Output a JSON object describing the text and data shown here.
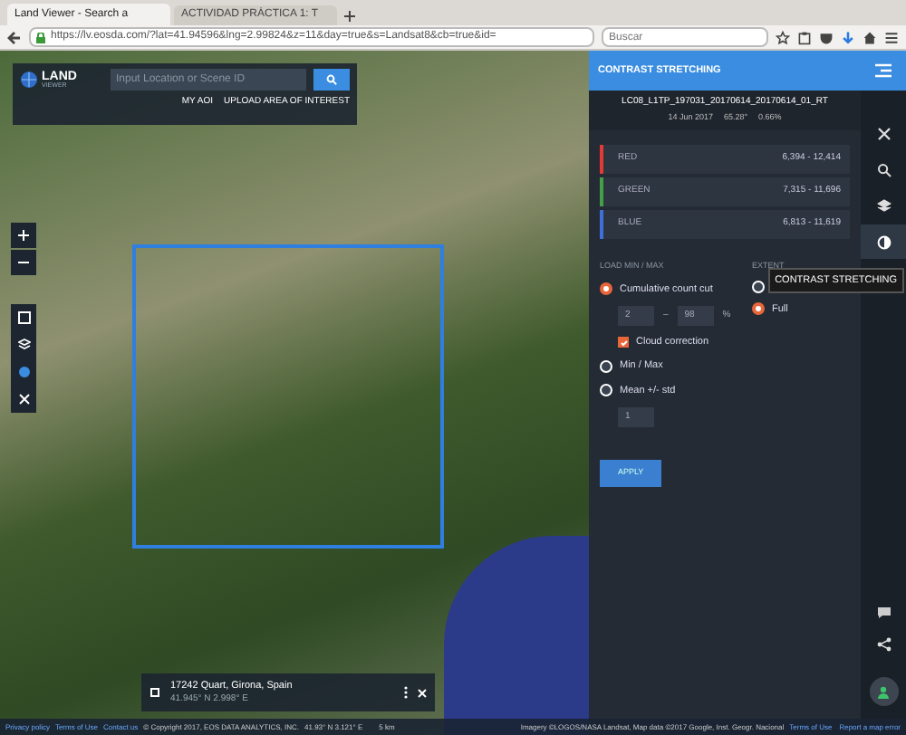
{
  "browser": {
    "tabs": [
      {
        "label": "Land Viewer - Search a",
        "selected": true
      },
      {
        "label": "ACTIVIDAD PRÁCTICA 1: T",
        "selected": false
      }
    ],
    "url": "https://lv.eosda.com/?lat=41.94596&lng=2.99824&z=11&day=true&s=Landsat8&cb=true&id=",
    "search": {
      "placeholder": "Buscar"
    }
  },
  "map": {
    "logo": {
      "word": "LAND",
      "sub": "VIEWER"
    },
    "search": {
      "placeholder": "Input Location or Scene ID"
    },
    "links": [
      "MY AOI",
      "UPLOAD AREA OF INTEREST"
    ],
    "location_card": {
      "title": "17242 Quart, Girona, Spain",
      "coords": "41.945° N 2.998° E"
    },
    "footer": {
      "links": [
        "Privacy policy",
        "Terms of Use",
        "Contact us"
      ],
      "copyright": "© Copyright 2017, EOS DATA ANALYTICS, INC.",
      "cursor": "41.93° N 3.121° E",
      "scale": "5 km",
      "attribution": "Imagery ©LOGOS/NASA Landsat, Map data ©2017 Google, Inst. Geogr. Nacional",
      "right_links": [
        "Terms of Use",
        "Report a map error"
      ]
    }
  },
  "panel": {
    "title": "CONTRAST STRETCHING",
    "scene": "LC08_L1TP_197031_20170614_20170614_01_RT",
    "date": "14 Jun 2017",
    "angle": "65.28°",
    "cloud": "0.66%",
    "bands": [
      {
        "name": "RED",
        "range": "6,394 - 12,414",
        "color": "#e53935"
      },
      {
        "name": "GREEN",
        "range": "7,315 - 11,696",
        "color": "#43a047"
      },
      {
        "name": "BLUE",
        "range": "6,813 - 11,619",
        "color": "#3f6fd8"
      }
    ],
    "load_heading": "LOAD MIN / MAX",
    "extent_heading": "EXTENT",
    "methods": [
      {
        "label": "Cumulative count cut",
        "selected": true,
        "kind": "range",
        "min": "2",
        "sep": "–",
        "max": "98",
        "unit": "%",
        "cloud_label": "Cloud correction",
        "cloud_checked": true
      },
      {
        "label": "Min / Max",
        "selected": false,
        "kind": "plain"
      },
      {
        "label": "Mean +/- std",
        "selected": false,
        "kind": "value",
        "value": "1"
      }
    ],
    "extent": [
      {
        "selected": false
      },
      {
        "label": "Full",
        "selected": true
      }
    ],
    "apply": "APPLY"
  },
  "rail": {
    "tools": [
      {
        "selected": false
      },
      {
        "selected": false
      },
      {
        "selected": false
      },
      {
        "selected": true
      }
    ],
    "tooltip": "CONTRAST STRETCHING"
  }
}
